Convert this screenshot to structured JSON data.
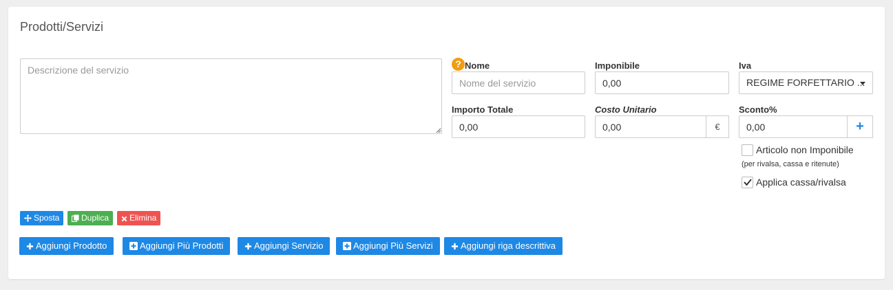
{
  "section": {
    "title": "Prodotti/Servizi"
  },
  "description": {
    "placeholder": "Descrizione del servizio"
  },
  "fields": {
    "nome": {
      "label": "Nome",
      "placeholder": "Nome del servizio",
      "value": ""
    },
    "imponibile": {
      "label": "Imponibile",
      "value": "0,00"
    },
    "iva": {
      "label": "Iva",
      "selected": "REGIME FORFETTARIO ..."
    },
    "importo_totale": {
      "label": "Importo Totale",
      "value": "0,00"
    },
    "costo_unitario": {
      "label": "Costo Unitario",
      "value": "0,00",
      "currency": "€"
    },
    "sconto": {
      "label": "Sconto%",
      "value": "0,00",
      "add": "+"
    }
  },
  "help_icon": "?",
  "checkboxes": {
    "non_imponibile": {
      "label": "Articolo non Imponibile",
      "note": "(per rivalsa, cassa e ritenute)",
      "checked": false
    },
    "cassa_rivalsa": {
      "label": "Applica cassa/rivalsa",
      "checked": true
    }
  },
  "row_actions": {
    "sposta": "Sposta",
    "duplica": "Duplica",
    "elimina": "Elimina"
  },
  "add_buttons": {
    "prodotto": "Aggiungi Prodotto",
    "piu_prodotti": "Aggiungi Più Prodotti",
    "servizio": "Aggiungi Servizio",
    "piu_servizi": "Aggiungi Più Servizi",
    "riga_descrittiva": "Aggiungi riga descrittiva"
  },
  "colors": {
    "primary": "#1e88e5",
    "success": "#4caf50",
    "danger": "#ef5350",
    "help": "#f39c12"
  }
}
